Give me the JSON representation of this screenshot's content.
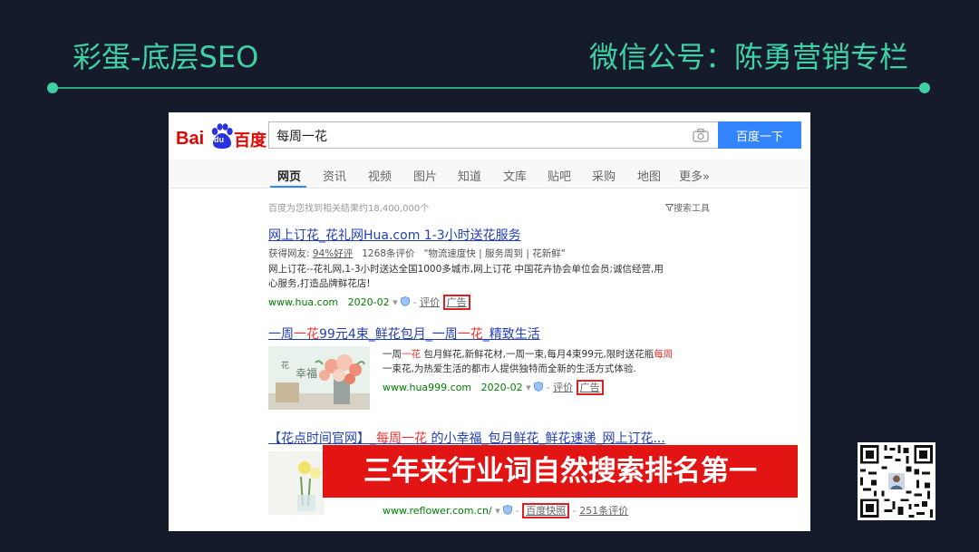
{
  "slide": {
    "title_left": "彩蛋-底层SEO",
    "title_right": "微信公号：陈勇营销专栏"
  },
  "baidu": {
    "logo_bai": "Bai",
    "logo_du": "du",
    "logo_cn": "百度",
    "query": "每周一花",
    "search_button": "百度一下",
    "tabs": [
      "网页",
      "资讯",
      "视频",
      "图片",
      "知道",
      "文库",
      "贴吧",
      "采购",
      "地图",
      "更多»"
    ],
    "result_count": "百度为您找到相关结果约18,400,000个",
    "search_tools": "搜索工具"
  },
  "results": [
    {
      "title": "网上订花_花礼网Hua.com 1-3小时送花服务",
      "rating_prefix": "获得网友:",
      "rating_good": "94%好评",
      "rating_count": "1268条评价",
      "rating_tags": "\"物流速度快 | 服务周到 | 花新鲜\"",
      "desc_line1": "网上订花--花礼网,1-3小时送达全国1000多城市,网上订花 中国花卉协会单位会员;诚信经营,用",
      "desc_line2": "心服务,打造品牌鲜花店!",
      "url": "www.hua.com",
      "date": "2020-02",
      "review": "评价",
      "ad": "广告"
    },
    {
      "title_a": "一周",
      "title_hl": "一花",
      "title_b": "99元4束_鲜花包月_一周",
      "title_hl2": "一花",
      "title_c": "_精致生活",
      "desc_a": "一周",
      "desc_hl": "一花",
      "desc_b": " 包月鲜花,新鲜花材,一周一束,每月4束99元,限时送花瓶",
      "desc_hl2": "每周",
      "desc_line2": "一束花,为热爱生活的都市人提供独特而全新的生活方式体验.",
      "url": "www.hua999.com",
      "date": "2020-02",
      "review": "评价",
      "ad": "广告",
      "thumb_text_a": "花",
      "thumb_text_b": "幸福"
    },
    {
      "title_a": "【花点时间官网】_",
      "title_hl": "每周一花",
      "title_b": " 的小幸福_包月鲜花_鲜花速递_网上订花...",
      "url": "www.reflower.com.cn/",
      "snapshot": "百度快照",
      "reviews": "251条评价"
    }
  ],
  "banner_text": "三年来行业词自然搜索排名第一",
  "colors": {
    "accent": "#3fd1a6",
    "baidu_red": "#e10602",
    "baidu_blue": "#3385ff",
    "link_blue": "#2440b3",
    "banner_red": "#e31414"
  }
}
